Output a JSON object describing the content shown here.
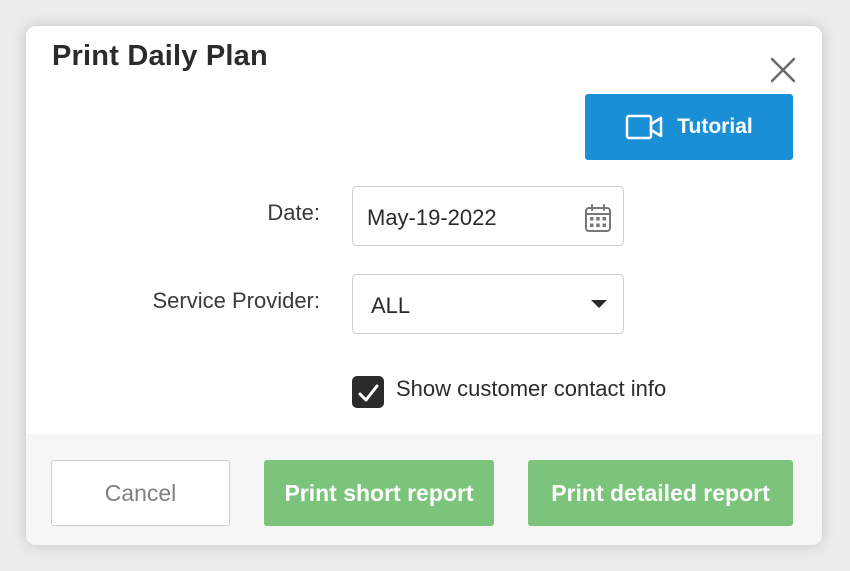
{
  "dialog": {
    "title": "Print Daily Plan",
    "tutorial_label": "Tutorial",
    "date": {
      "label": "Date:",
      "value": "May-19-2022"
    },
    "service_provider": {
      "label": "Service Provider:",
      "value": "ALL"
    },
    "show_contact": {
      "label": "Show customer contact info",
      "checked": true
    },
    "buttons": {
      "cancel": "Cancel",
      "print_short": "Print short report",
      "print_detailed": "Print detailed report"
    }
  },
  "colors": {
    "tutorial_bg": "#1a8fd6",
    "print_btn_bg": "#7cc47c",
    "checkbox_bg": "#2b2b2b"
  },
  "icons": {
    "close": "close-icon",
    "tutorial": "video-camera-icon",
    "date": "calendar-icon",
    "dropdown": "caret-down-icon",
    "checkbox": "checkmark-icon"
  }
}
